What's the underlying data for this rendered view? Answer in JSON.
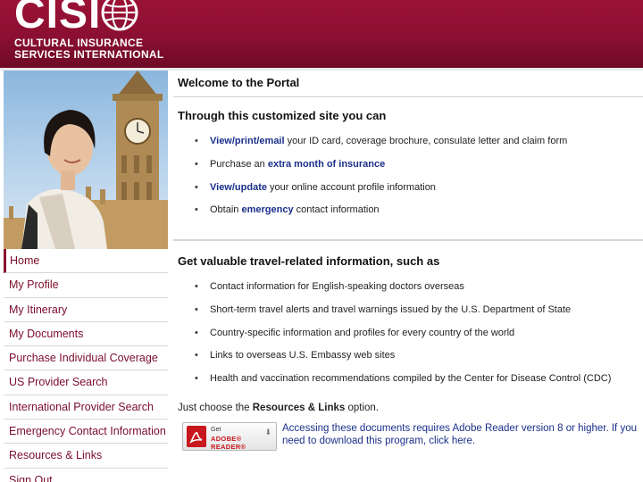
{
  "brand": {
    "wordmark": "CISI",
    "subtitle_line1": "CULTURAL INSURANCE",
    "subtitle_line2": "SERVICES INTERNATIONAL",
    "color_primary": "#8a0f30"
  },
  "nav": {
    "items": [
      {
        "label": "Home",
        "active": true
      },
      {
        "label": "My Profile"
      },
      {
        "label": "My Itinerary"
      },
      {
        "label": "My Documents"
      },
      {
        "label": "Purchase Individual Coverage"
      },
      {
        "label": "US Provider Search"
      },
      {
        "label": "International Provider Search"
      },
      {
        "label": "Emergency Contact Information"
      },
      {
        "label": "Resources & Links"
      },
      {
        "label": "Sign Out"
      }
    ]
  },
  "welcome": {
    "title": "Welcome to the Portal"
  },
  "section1": {
    "title": "Through this customized site you can",
    "items": [
      {
        "pre": "",
        "link": "View/print/email",
        "post": " your ID card, coverage brochure, consulate letter and claim form"
      },
      {
        "pre": "Purchase an ",
        "link": "extra month of insurance",
        "post": ""
      },
      {
        "pre": "",
        "link": "View/update",
        "post": " your online account profile information"
      },
      {
        "pre": "Obtain ",
        "link": "emergency",
        "post": " contact information"
      }
    ]
  },
  "section2": {
    "title": "Get valuable travel-related information, such as",
    "items": [
      "Contact information for English-speaking doctors overseas",
      "Short-term travel alerts and travel warnings issued by the U.S. Department of State",
      "Country-specific information and profiles for every country of the world",
      "Links to overseas U.S. Embassy web sites",
      "Health and vaccination recommendations compiled by the Center for Disease Control (CDC)"
    ],
    "note_pre": "Just choose the ",
    "note_bold": "Resources & Links",
    "note_post": " option."
  },
  "adobe": {
    "get": "Get",
    "name": "ADOBE® READER®",
    "text": "Accessing these documents requires Adobe Reader version 8 or higher. If you need to download this program, click here."
  }
}
